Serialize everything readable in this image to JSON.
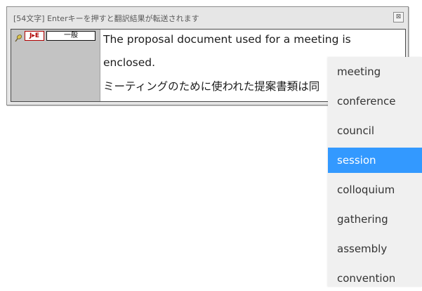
{
  "window": {
    "title": "[54文字] Enterキーを押すと翻訳結果が転送されます",
    "close_symbol": "⊠"
  },
  "panel": {
    "direction_badge": "J▸E",
    "mode_badge": "一般",
    "pin_icon": "pin-icon"
  },
  "text": {
    "line1": "The proposal document used for a meeting is",
    "line2": "enclosed.",
    "line3": "ミーティングのために使われた提案書類は同"
  },
  "dropdown": {
    "selected_index": 3,
    "items": [
      "meeting",
      "conference",
      "council",
      "session",
      "colloquium",
      "gathering",
      "assembly",
      "convention"
    ]
  },
  "colors": {
    "selection": "#3399ff",
    "badge_red": "#b00000",
    "panel_gray": "#c3c3c3"
  }
}
